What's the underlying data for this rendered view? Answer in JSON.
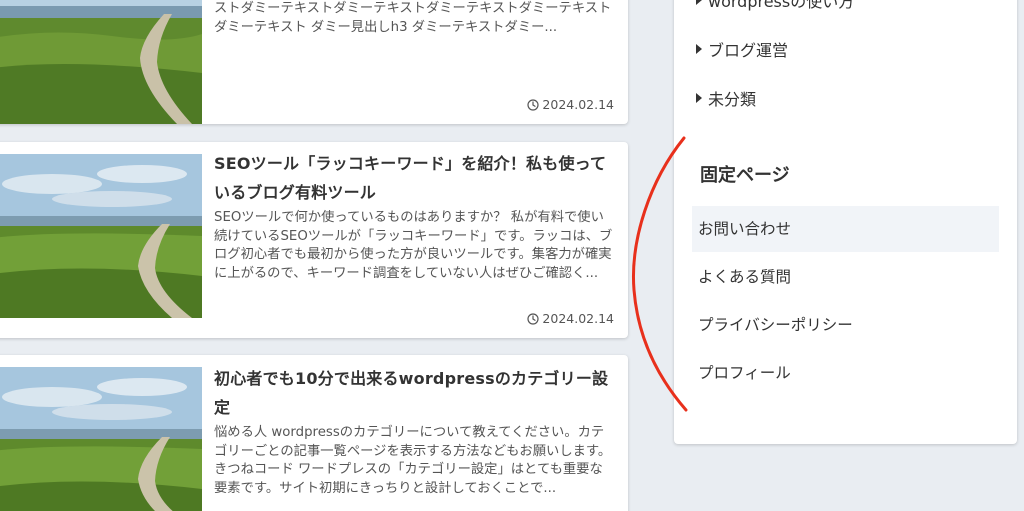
{
  "articles": [
    {
      "title": "",
      "excerpt": "ストダミーテキストダミーテキストダミーテキストダミーテキストダミーテキスト ダミー見出しh3 ダミーテキストダミー...",
      "date": "2024.02.14"
    },
    {
      "title": "SEOツール「ラッコキーワード」を紹介！私も使っているブログ有料ツール",
      "excerpt": "SEOツールで何か使っているものはありますか？ 私が有料で使い続けているSEOツールが「ラッコキーワード」です。ラッコは、ブログ初心者でも最初から使った方が良いツールです。集客力が確実に上がるので、キーワード調査をしていない人はぜひご確認く...",
      "date": "2024.02.14"
    },
    {
      "title": "初心者でも10分で出来るwordpressのカテゴリー設定",
      "excerpt": "悩める人 wordpressのカテゴリーについて教えてください。カテゴリーごとの記事一覧ページを表示する方法などもお願いします。 きつねコード ワードプレスの「カテゴリー設定」はとても重要な要素です。サイト初期にきっちりと設計しておくことで...",
      "date": ""
    }
  ],
  "sidebar": {
    "categories": [
      {
        "label": "wordpressの使い方"
      },
      {
        "label": "ブログ運営"
      },
      {
        "label": "未分類"
      }
    ],
    "pages_title": "固定ページ",
    "pages": [
      {
        "label": "お問い合わせ"
      },
      {
        "label": "よくある質問"
      },
      {
        "label": "プライバシーポリシー"
      },
      {
        "label": "プロフィール"
      }
    ]
  },
  "icons": {
    "date": "clock-icon",
    "category": "triangle-right-icon"
  },
  "colors": {
    "page_background": "#e9edf2",
    "annotation": "#e8301c",
    "active_item": "#f1f4f8"
  }
}
